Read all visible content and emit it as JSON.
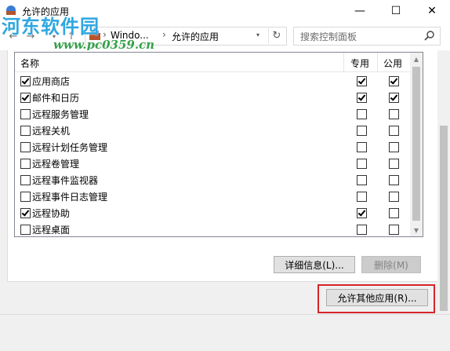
{
  "window": {
    "title": "允许的应用",
    "minimize_glyph": "—",
    "maximize_glyph": "☐",
    "close_glyph": "✕"
  },
  "watermark": {
    "text": "河东软件园",
    "url": "www.pc0359.cn"
  },
  "nav": {
    "back_glyph": "←",
    "forward_glyph": "→",
    "up_glyph": "↑",
    "address_segments": [
      "Windo...",
      "允许的应用"
    ],
    "separator_glyph": "›",
    "refresh_glyph": "↻",
    "search_placeholder": "搜索控制面板"
  },
  "list": {
    "columns": {
      "name": "名称",
      "private": "专用",
      "public": "公用"
    },
    "rows": [
      {
        "name": "应用商店",
        "enabled": true,
        "private": true,
        "public": true
      },
      {
        "name": "邮件和日历",
        "enabled": true,
        "private": true,
        "public": true
      },
      {
        "name": "远程服务管理",
        "enabled": false,
        "private": false,
        "public": false
      },
      {
        "name": "远程关机",
        "enabled": false,
        "private": false,
        "public": false
      },
      {
        "name": "远程计划任务管理",
        "enabled": false,
        "private": false,
        "public": false
      },
      {
        "name": "远程卷管理",
        "enabled": false,
        "private": false,
        "public": false
      },
      {
        "name": "远程事件监视器",
        "enabled": false,
        "private": false,
        "public": false
      },
      {
        "name": "远程事件日志管理",
        "enabled": false,
        "private": false,
        "public": false
      },
      {
        "name": "远程协助",
        "enabled": true,
        "private": true,
        "public": false
      },
      {
        "name": "远程桌面",
        "enabled": false,
        "private": false,
        "public": false
      }
    ]
  },
  "buttons": {
    "details": "详细信息(L)...",
    "remove": "删除(M)",
    "allow_other": "允许其他应用(R)..."
  },
  "colors": {
    "highlight_border": "#d6252a",
    "watermark_blue": "#2fa7e0",
    "watermark_green": "#35a04a"
  }
}
